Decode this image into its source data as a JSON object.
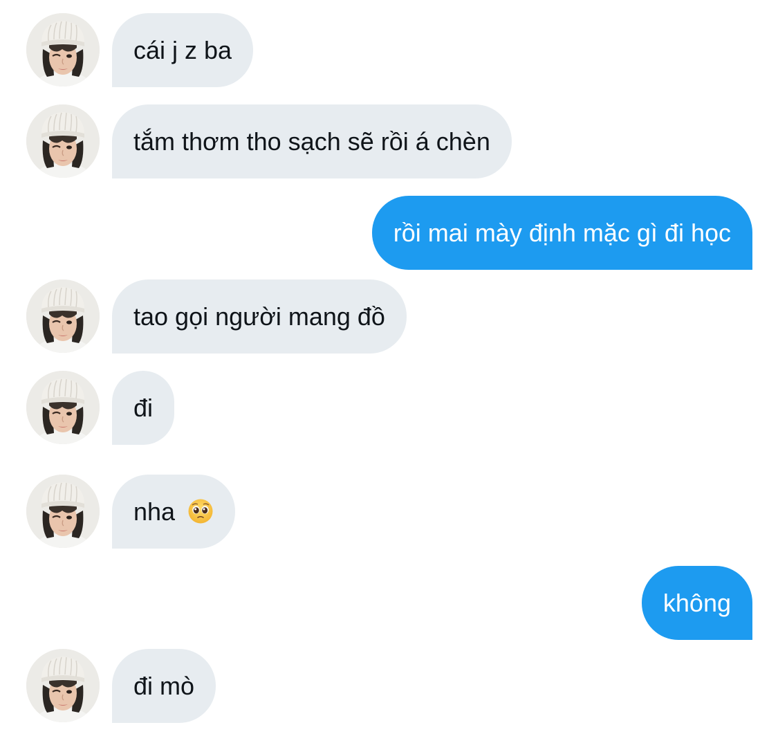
{
  "conversation": {
    "messages": [
      {
        "sender": "them",
        "text": "cái j z ba"
      },
      {
        "sender": "them",
        "text": "tắm thơm tho sạch sẽ rồi á chèn"
      },
      {
        "sender": "me",
        "text": "rồi mai mày định mặc gì đi học"
      },
      {
        "sender": "them",
        "text": "tao gọi người mang đồ"
      },
      {
        "sender": "them",
        "text": "đi"
      },
      {
        "sender": "them",
        "text": "nha",
        "emoji": "pleading-face"
      },
      {
        "sender": "me",
        "text": "không"
      },
      {
        "sender": "them",
        "text": "đi mò"
      }
    ]
  },
  "colors": {
    "incoming_bubble": "#e7ecf0",
    "outgoing_bubble": "#1d9bf0",
    "incoming_text": "#0f1419",
    "outgoing_text": "#ffffff"
  }
}
